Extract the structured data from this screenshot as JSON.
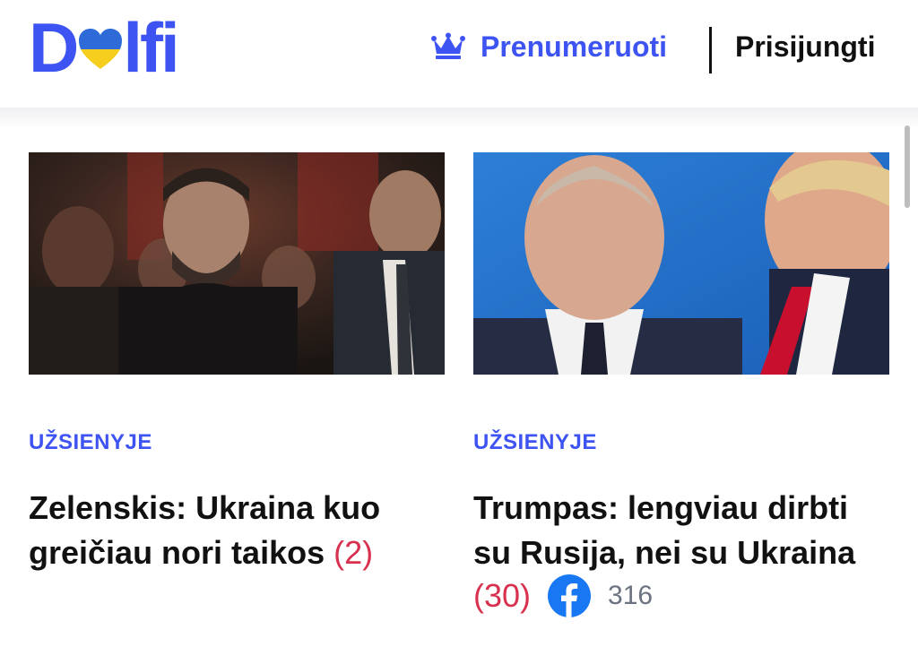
{
  "header": {
    "logo_text_left": "D",
    "logo_text_right": "lfi",
    "subscribe_label": "Prenumeruoti",
    "login_label": "Prisijungti"
  },
  "articles": [
    {
      "category": "UŽSIENYJE",
      "title": "Zelenskis: Ukraina kuo greičiau nori taikos",
      "comment_count": "(2)"
    },
    {
      "category": "UŽSIENYJE",
      "title": "Trumpas: lengviau dirbti su Rusija, nei su Ukraina",
      "comment_count": "(30)",
      "facebook_shares": "316"
    }
  ],
  "colors": {
    "brand": "#3d53f2",
    "comment": "#d8314f",
    "heart_top": "#2f6bd8",
    "heart_bottom": "#f6cf1e"
  }
}
